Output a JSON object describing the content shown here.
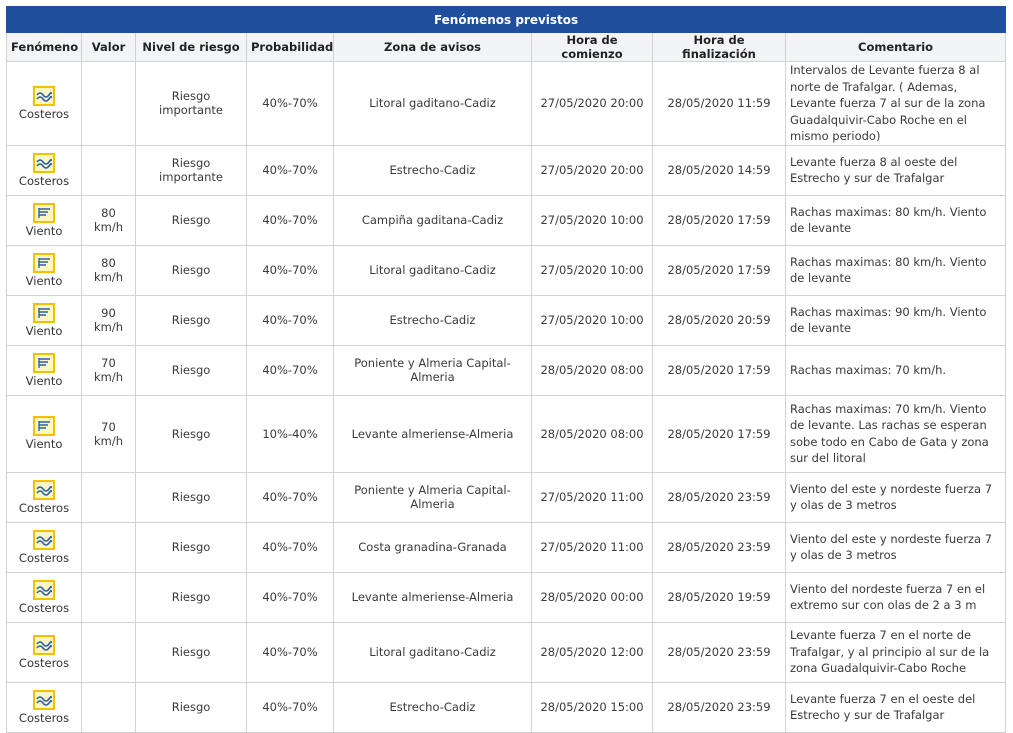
{
  "title": "Fenómenos previstos",
  "columns": [
    "Fenómeno",
    "Valor",
    "Nivel de riesgo",
    "Probabilidad",
    "Zona de avisos",
    "Hora de comienzo",
    "Hora de finalización",
    "Comentario"
  ],
  "colors": {
    "header_bg": "#1f4e9c",
    "icon_border": "#f2c200",
    "icon_fill": "#fff7c2",
    "icon_glyph": "#2b5fb5"
  },
  "rows": [
    {
      "icon": "coastal-icon",
      "fenomeno": "Costeros",
      "valor": "",
      "nivel": "Riesgo importante",
      "probabilidad": "40%-70%",
      "zona": "Litoral gaditano-Cadiz",
      "inicio": "27/05/2020 20:00",
      "fin": "28/05/2020 11:59",
      "comentario": "Intervalos de Levante fuerza 8 al norte de Trafalgar. ( Ademas, Levante fuerza 7 al sur de la zona Guadalquivir-Cabo Roche en el mismo periodo)"
    },
    {
      "icon": "coastal-icon",
      "fenomeno": "Costeros",
      "valor": "",
      "nivel": "Riesgo importante",
      "probabilidad": "40%-70%",
      "zona": "Estrecho-Cadiz",
      "inicio": "27/05/2020 20:00",
      "fin": "28/05/2020 14:59",
      "comentario": "Levante fuerza 8 al oeste del Estrecho y sur de Trafalgar"
    },
    {
      "icon": "wind-icon",
      "fenomeno": "Viento",
      "valor": "80 km/h",
      "nivel": "Riesgo",
      "probabilidad": "40%-70%",
      "zona": "Campiña gaditana-Cadiz",
      "inicio": "27/05/2020 10:00",
      "fin": "28/05/2020 17:59",
      "comentario": "Rachas maximas: 80 km/h. Viento de levante"
    },
    {
      "icon": "wind-icon",
      "fenomeno": "Viento",
      "valor": "80 km/h",
      "nivel": "Riesgo",
      "probabilidad": "40%-70%",
      "zona": "Litoral gaditano-Cadiz",
      "inicio": "27/05/2020 10:00",
      "fin": "28/05/2020 17:59",
      "comentario": "Rachas maximas: 80 km/h. Viento de levante"
    },
    {
      "icon": "wind-icon",
      "fenomeno": "Viento",
      "valor": "90 km/h",
      "nivel": "Riesgo",
      "probabilidad": "40%-70%",
      "zona": "Estrecho-Cadiz",
      "inicio": "27/05/2020 10:00",
      "fin": "28/05/2020 20:59",
      "comentario": "Rachas maximas: 90 km/h. Viento de levante"
    },
    {
      "icon": "wind-icon",
      "fenomeno": "Viento",
      "valor": "70 km/h",
      "nivel": "Riesgo",
      "probabilidad": "40%-70%",
      "zona": "Poniente y Almeria Capital-Almeria",
      "inicio": "28/05/2020 08:00",
      "fin": "28/05/2020 17:59",
      "comentario": "Rachas maximas: 70 km/h."
    },
    {
      "icon": "wind-icon",
      "fenomeno": "Viento",
      "valor": "70 km/h",
      "nivel": "Riesgo",
      "probabilidad": "10%-40%",
      "zona": "Levante almeriense-Almeria",
      "inicio": "28/05/2020 08:00",
      "fin": "28/05/2020 17:59",
      "comentario": "Rachas maximas: 70 km/h. Viento de levante. Las rachas se esperan sobe todo en Cabo de Gata y zona sur del litoral"
    },
    {
      "icon": "coastal-icon",
      "fenomeno": "Costeros",
      "valor": "",
      "nivel": "Riesgo",
      "probabilidad": "40%-70%",
      "zona": "Poniente y Almeria Capital-Almeria",
      "inicio": "27/05/2020 11:00",
      "fin": "28/05/2020 23:59",
      "comentario": "Viento del este y nordeste fuerza 7 y olas de 3 metros"
    },
    {
      "icon": "coastal-icon",
      "fenomeno": "Costeros",
      "valor": "",
      "nivel": "Riesgo",
      "probabilidad": "40%-70%",
      "zona": "Costa granadina-Granada",
      "inicio": "27/05/2020 11:00",
      "fin": "28/05/2020 23:59",
      "comentario": "Viento del este y nordeste fuerza 7 y olas de 3 metros"
    },
    {
      "icon": "coastal-icon",
      "fenomeno": "Costeros",
      "valor": "",
      "nivel": "Riesgo",
      "probabilidad": "40%-70%",
      "zona": "Levante almeriense-Almeria",
      "inicio": "28/05/2020 00:00",
      "fin": "28/05/2020 19:59",
      "comentario": "Viento del nordeste fuerza 7 en el extremo sur con olas de 2 a 3 m"
    },
    {
      "icon": "coastal-icon",
      "fenomeno": "Costeros",
      "valor": "",
      "nivel": "Riesgo",
      "probabilidad": "40%-70%",
      "zona": "Litoral gaditano-Cadiz",
      "inicio": "28/05/2020 12:00",
      "fin": "28/05/2020 23:59",
      "comentario": "Levante fuerza 7 en el norte de Trafalgar, y al principio al sur de la zona Guadalquivir-Cabo Roche"
    },
    {
      "icon": "coastal-icon",
      "fenomeno": "Costeros",
      "valor": "",
      "nivel": "Riesgo",
      "probabilidad": "40%-70%",
      "zona": "Estrecho-Cadiz",
      "inicio": "28/05/2020 15:00",
      "fin": "28/05/2020 23:59",
      "comentario": "Levante fuerza 7 en el oeste del Estrecho y sur de Trafalgar"
    }
  ]
}
